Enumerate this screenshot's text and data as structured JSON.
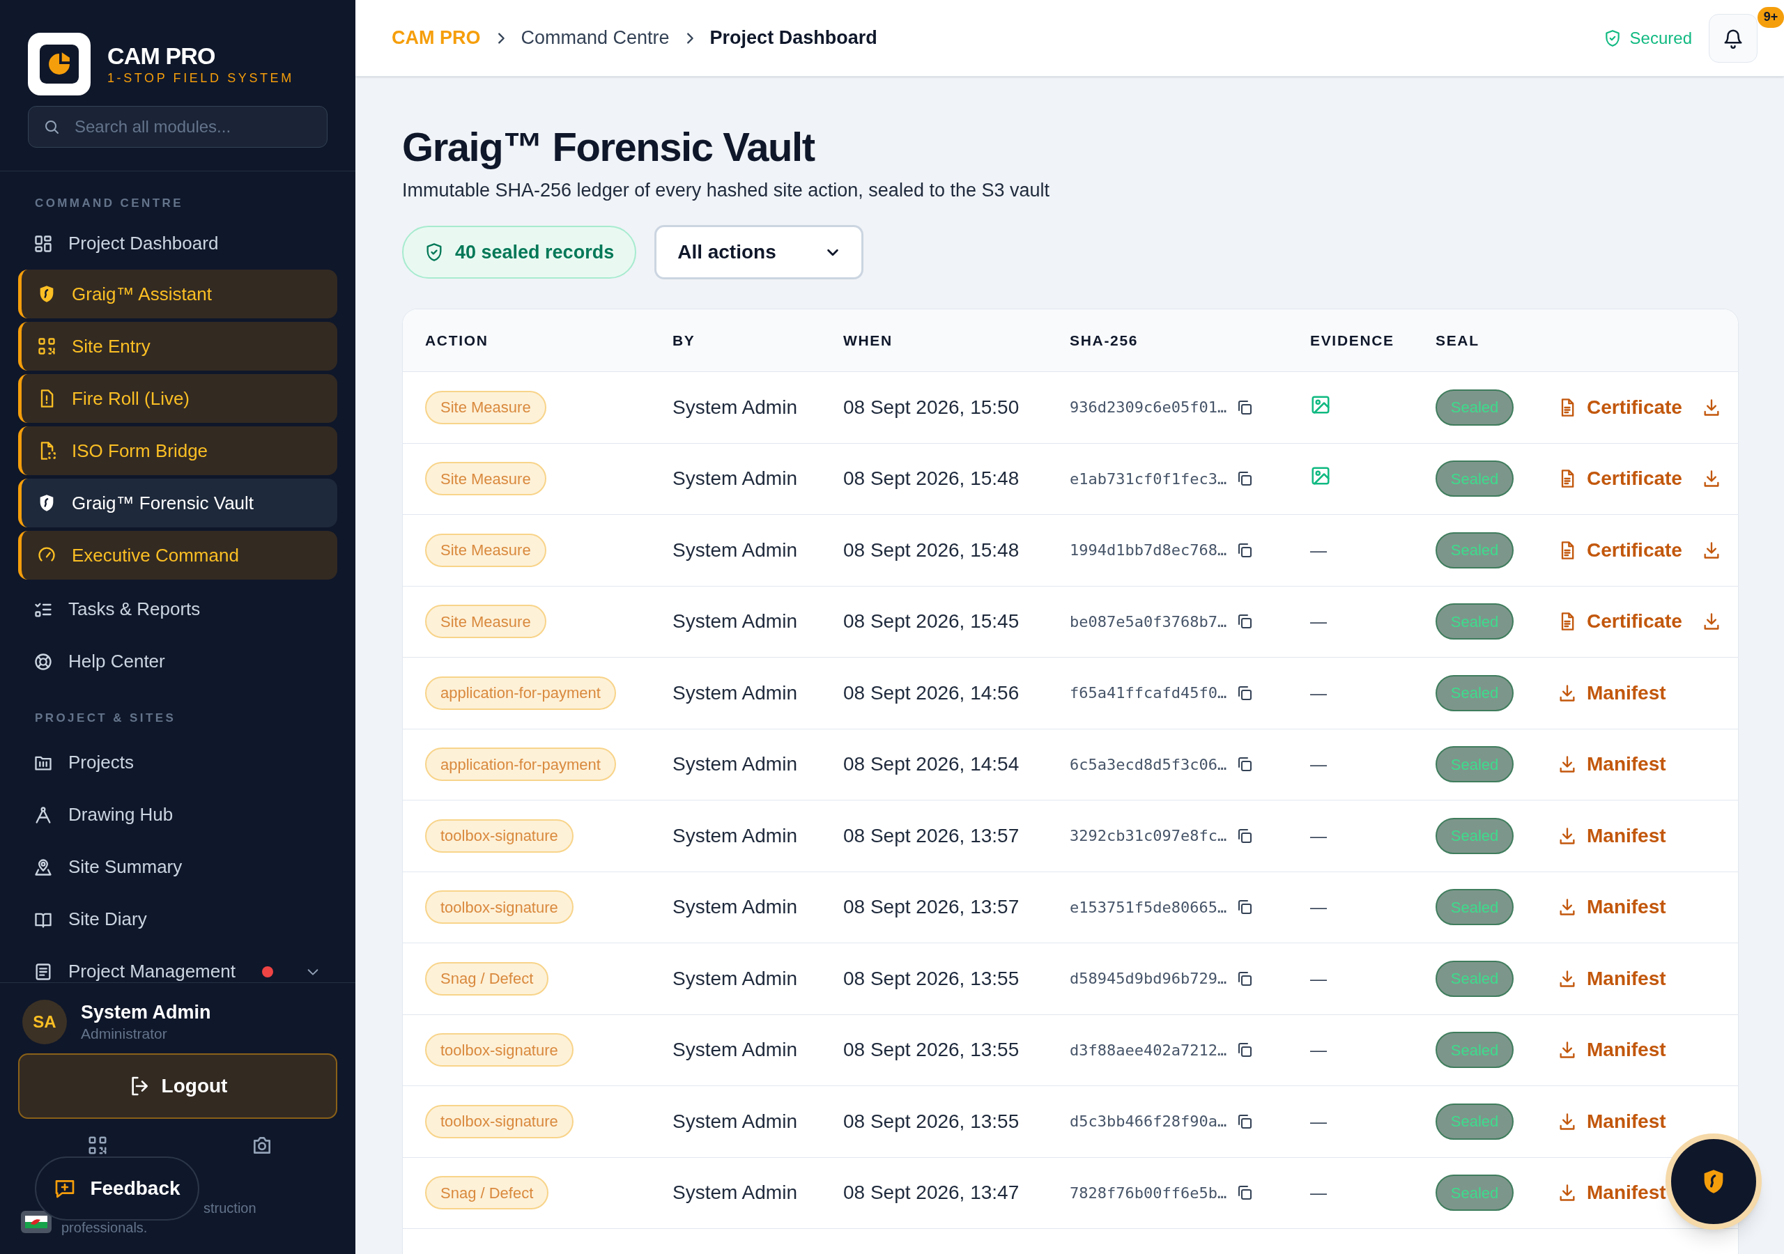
{
  "brand": {
    "name": "CAM PRO",
    "tagline": "1-STOP FIELD SYSTEM"
  },
  "sidebar": {
    "search": {
      "placeholder": "Search all modules..."
    },
    "sections": [
      {
        "title": "COMMAND CENTRE",
        "items": [
          {
            "label": "Project Dashboard",
            "highlighted": false,
            "selected": false
          },
          {
            "label": "Graig™ Assistant",
            "highlighted": true,
            "selected": false
          },
          {
            "label": "Site Entry",
            "highlighted": true,
            "selected": false
          },
          {
            "label": "Fire Roll (Live)",
            "highlighted": true,
            "selected": false
          },
          {
            "label": "ISO Form Bridge",
            "highlighted": true,
            "selected": false
          },
          {
            "label": "Graig™ Forensic Vault",
            "highlighted": true,
            "selected": true
          },
          {
            "label": "Executive Command",
            "highlighted": true,
            "selected": false
          },
          {
            "label": "Tasks & Reports",
            "highlighted": false,
            "selected": false
          },
          {
            "label": "Help Center",
            "highlighted": false,
            "selected": false
          }
        ]
      },
      {
        "title": "PROJECT & SITES",
        "items": [
          {
            "label": "Projects",
            "selected": false,
            "alert": false
          },
          {
            "label": "Drawing Hub",
            "selected": false,
            "alert": false
          },
          {
            "label": "Site Summary",
            "selected": false,
            "alert": false
          },
          {
            "label": "Site Diary",
            "selected": false,
            "alert": false
          },
          {
            "label": "Project Management",
            "selected": false,
            "alert": true,
            "expanded": false
          }
        ]
      }
    ],
    "user": {
      "initials": "SA",
      "name": "System Admin",
      "role": "Administrator"
    },
    "logout": "Logout",
    "feedback": "Feedback",
    "footer_lines": [
      "struction",
      "professionals."
    ]
  },
  "header": {
    "breadcrumb": [
      "CAM PRO",
      "Command Centre",
      "Project Dashboard"
    ],
    "status": "Secured",
    "notifications": "9+"
  },
  "page": {
    "title": "Graig™ Forensic Vault",
    "subtitle": "Immutable SHA-256 ledger of every hashed site action, sealed to the S3 vault",
    "records_badge": "40 sealed records",
    "filter": {
      "value": "All actions"
    }
  },
  "table": {
    "columns": [
      "ACTION",
      "BY",
      "WHEN",
      "SHA-256",
      "EVIDENCE",
      "SEAL"
    ],
    "rows": [
      {
        "action": "Site Measure",
        "by": "System Admin",
        "when": "08 Sept 2026, 15:50",
        "hash": "936d2309c6e05f01…",
        "evidence": {
          "kind": "image"
        },
        "seal": "Sealed",
        "links": [
          {
            "kind": "certificate",
            "label": "Certificate"
          },
          {
            "kind": "manifest"
          }
        ]
      },
      {
        "action": "Site Measure",
        "by": "System Admin",
        "when": "08 Sept 2026, 15:48",
        "hash": "e1ab731cf0f1fec3…",
        "evidence": {
          "kind": "image"
        },
        "seal": "Sealed",
        "links": [
          {
            "kind": "certificate",
            "label": "Certificate"
          },
          {
            "kind": "manifest"
          }
        ]
      },
      {
        "action": "Site Measure",
        "by": "System Admin",
        "when": "08 Sept 2026, 15:48",
        "hash": "1994d1bb7d8ec768…",
        "evidence": {
          "kind": "none",
          "text": "—"
        },
        "seal": "Sealed",
        "links": [
          {
            "kind": "certificate",
            "label": "Certificate"
          },
          {
            "kind": "manifest"
          }
        ]
      },
      {
        "action": "Site Measure",
        "by": "System Admin",
        "when": "08 Sept 2026, 15:45",
        "hash": "be087e5a0f3768b7…",
        "evidence": {
          "kind": "none",
          "text": "—"
        },
        "seal": "Sealed",
        "links": [
          {
            "kind": "certificate",
            "label": "Certificate"
          },
          {
            "kind": "manifest"
          }
        ]
      },
      {
        "action": "application-for-payment",
        "by": "System Admin",
        "when": "08 Sept 2026, 14:56",
        "hash": "f65a41ffcafd45f0…",
        "evidence": {
          "kind": "none",
          "text": "—"
        },
        "seal": "Sealed",
        "links": [
          {
            "kind": "manifest",
            "label": "Manifest"
          }
        ]
      },
      {
        "action": "application-for-payment",
        "by": "System Admin",
        "when": "08 Sept 2026, 14:54",
        "hash": "6c5a3ecd8d5f3c06…",
        "evidence": {
          "kind": "none",
          "text": "—"
        },
        "seal": "Sealed",
        "links": [
          {
            "kind": "manifest",
            "label": "Manifest"
          }
        ]
      },
      {
        "action": "toolbox-signature",
        "by": "System Admin",
        "when": "08 Sept 2026, 13:57",
        "hash": "3292cb31c097e8fc…",
        "evidence": {
          "kind": "none",
          "text": "—"
        },
        "seal": "Sealed",
        "links": [
          {
            "kind": "manifest",
            "label": "Manifest"
          }
        ]
      },
      {
        "action": "toolbox-signature",
        "by": "System Admin",
        "when": "08 Sept 2026, 13:57",
        "hash": "e153751f5de80665…",
        "evidence": {
          "kind": "none",
          "text": "—"
        },
        "seal": "Sealed",
        "links": [
          {
            "kind": "manifest",
            "label": "Manifest"
          }
        ]
      },
      {
        "action": "Snag / Defect",
        "by": "System Admin",
        "when": "08 Sept 2026, 13:55",
        "hash": "d58945d9bd96b729…",
        "evidence": {
          "kind": "none",
          "text": "—"
        },
        "seal": "Sealed",
        "links": [
          {
            "kind": "manifest",
            "label": "Manifest"
          }
        ]
      },
      {
        "action": "toolbox-signature",
        "by": "System Admin",
        "when": "08 Sept 2026, 13:55",
        "hash": "d3f88aee402a7212…",
        "evidence": {
          "kind": "none",
          "text": "—"
        },
        "seal": "Sealed",
        "links": [
          {
            "kind": "manifest",
            "label": "Manifest"
          }
        ]
      },
      {
        "action": "toolbox-signature",
        "by": "System Admin",
        "when": "08 Sept 2026, 13:55",
        "hash": "d5c3bb466f28f90a…",
        "evidence": {
          "kind": "none",
          "text": "—"
        },
        "seal": "Sealed",
        "links": [
          {
            "kind": "manifest",
            "label": "Manifest"
          }
        ]
      },
      {
        "action": "Snag / Defect",
        "by": "System Admin",
        "when": "08 Sept 2026, 13:47",
        "hash": "7828f76b00ff6e5b…",
        "evidence": {
          "kind": "none",
          "text": "—"
        },
        "seal": "Sealed",
        "links": [
          {
            "kind": "manifest",
            "label": "Manifest"
          }
        ]
      }
    ]
  }
}
